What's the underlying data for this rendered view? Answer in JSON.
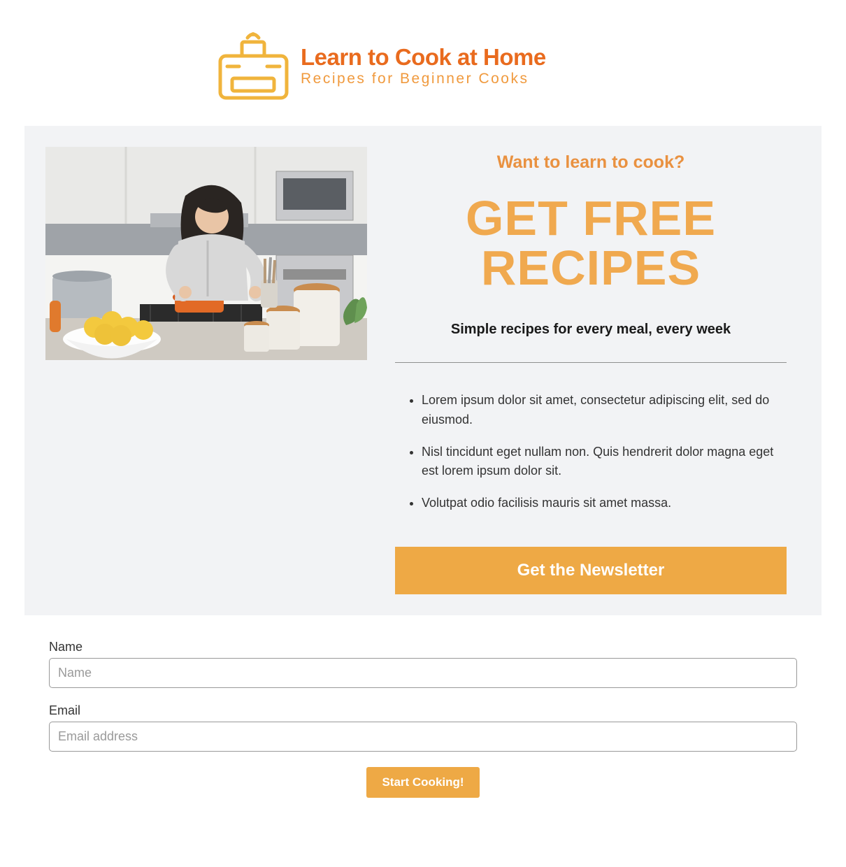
{
  "brand": {
    "title": "Learn to Cook at Home",
    "tagline": "Recipes for Beginner Cooks"
  },
  "hero": {
    "eyebrow": "Want to learn to cook?",
    "headline": "GET FREE RECIPES",
    "subhead": "Simple recipes for every meal, every week",
    "bullets": [
      "Lorem ipsum dolor sit amet, consectetur adipiscing elit, sed do eiusmod.",
      "Nisl tincidunt eget nullam non. Quis hendrerit dolor magna eget est lorem ipsum dolor sit.",
      "Volutpat odio facilisis mauris sit amet massa."
    ],
    "cta_label": "Get the Newsletter"
  },
  "form": {
    "name_label": "Name",
    "name_placeholder": "Name",
    "email_label": "Email",
    "email_placeholder": "Email address",
    "submit_label": "Start Cooking!"
  },
  "colors": {
    "brand_orange": "#E96B1E",
    "soft_orange": "#F0A94F",
    "cta_orange": "#EEA945",
    "hero_bg": "#F2F3F5"
  }
}
